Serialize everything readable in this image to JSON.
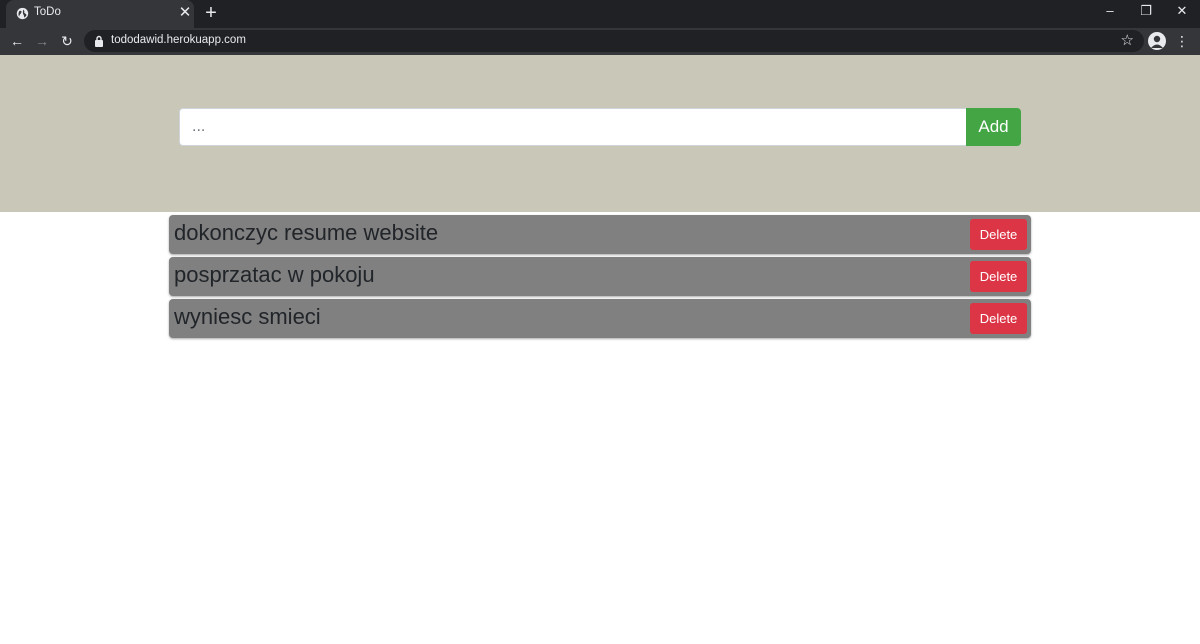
{
  "browser": {
    "tab_title": "ToDo",
    "tab_close": "✕",
    "new_tab": "+",
    "url": "tododawid.herokuapp.com",
    "window_controls": {
      "minimize": "–",
      "restore": "❐",
      "close": "✕"
    },
    "nav": {
      "back": "←",
      "forward": "→",
      "reload": "↻"
    },
    "bookmark": "☆",
    "menu": "⋮",
    "icons": [
      "globe-icon",
      "lock-icon",
      "star-icon",
      "avatar-icon",
      "kebab-menu-icon"
    ]
  },
  "form": {
    "placeholder": "...",
    "value": "",
    "add_label": "Add"
  },
  "todos": [
    {
      "text": "dokonczyc resume website",
      "delete_label": "Delete"
    },
    {
      "text": "posprzatac w pokoju",
      "delete_label": "Delete"
    },
    {
      "text": "wyniesc smieci",
      "delete_label": "Delete"
    }
  ],
  "colors": {
    "hero_bg": "#c9c7b8",
    "add_button": "#43a544",
    "delete_button": "#dc3545",
    "item_bg": "#808080"
  }
}
